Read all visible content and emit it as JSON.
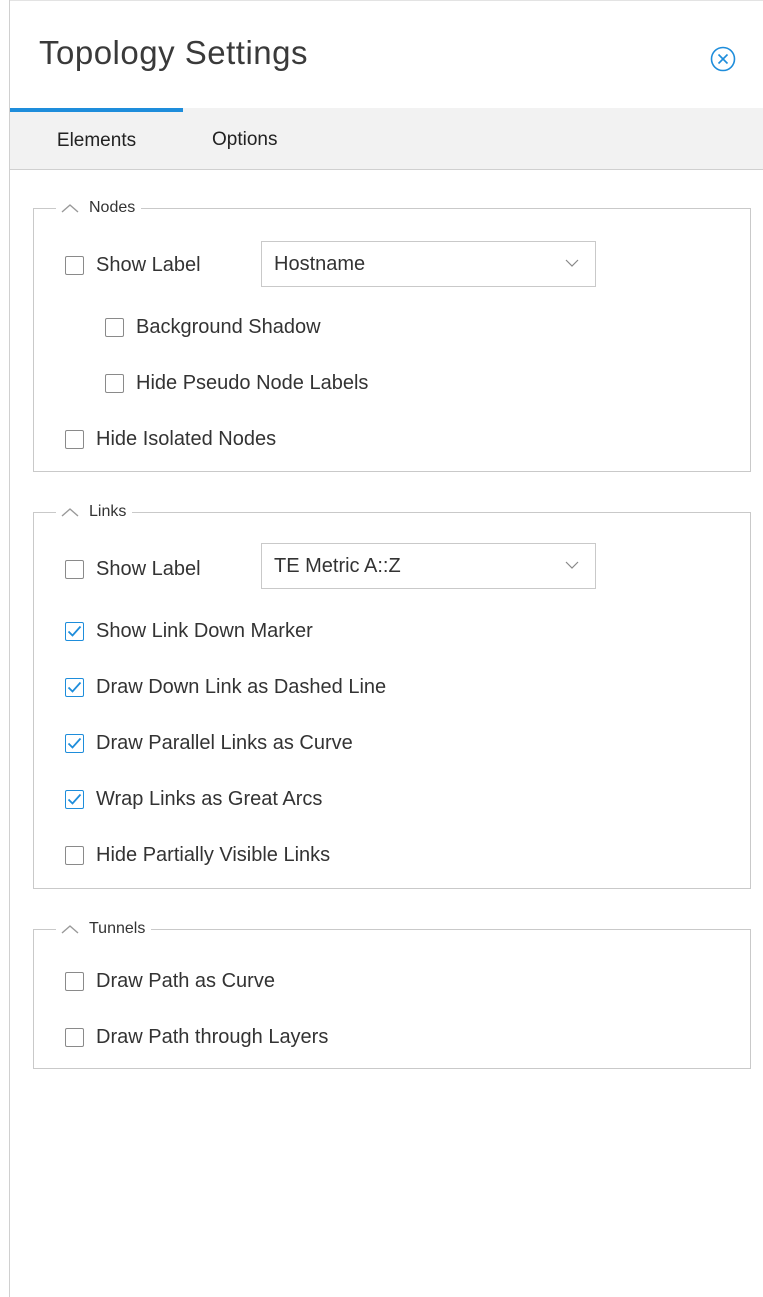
{
  "panel": {
    "title": "Topology Settings",
    "close_icon": "close-circle-icon"
  },
  "tabs": [
    {
      "label": "Elements",
      "active": true
    },
    {
      "label": "Options",
      "active": false
    }
  ],
  "groups": {
    "nodes": {
      "legend": "Nodes",
      "show_label": {
        "label": "Show Label",
        "checked": false
      },
      "label_select": {
        "value": "Hostname"
      },
      "background_shadow": {
        "label": "Background Shadow",
        "checked": false
      },
      "hide_pseudo": {
        "label": "Hide Pseudo Node Labels",
        "checked": false
      },
      "hide_isolated": {
        "label": "Hide Isolated Nodes",
        "checked": false
      }
    },
    "links": {
      "legend": "Links",
      "show_label": {
        "label": "Show Label",
        "checked": false
      },
      "label_select": {
        "value": "TE Metric A::Z"
      },
      "down_marker": {
        "label": "Show Link Down Marker",
        "checked": true
      },
      "dashed": {
        "label": "Draw Down Link as Dashed Line",
        "checked": true
      },
      "parallel_curve": {
        "label": "Draw Parallel Links as Curve",
        "checked": true
      },
      "great_arcs": {
        "label": "Wrap Links as Great Arcs",
        "checked": true
      },
      "hide_partial": {
        "label": "Hide Partially Visible Links",
        "checked": false
      }
    },
    "tunnels": {
      "legend": "Tunnels",
      "path_curve": {
        "label": "Draw Path as Curve",
        "checked": false
      },
      "path_layers": {
        "label": "Draw Path through Layers",
        "checked": false
      }
    }
  },
  "colors": {
    "accent": "#1e8ddb",
    "tab_bar_bg": "#f2f2f2",
    "border": "#c9c9c9"
  }
}
